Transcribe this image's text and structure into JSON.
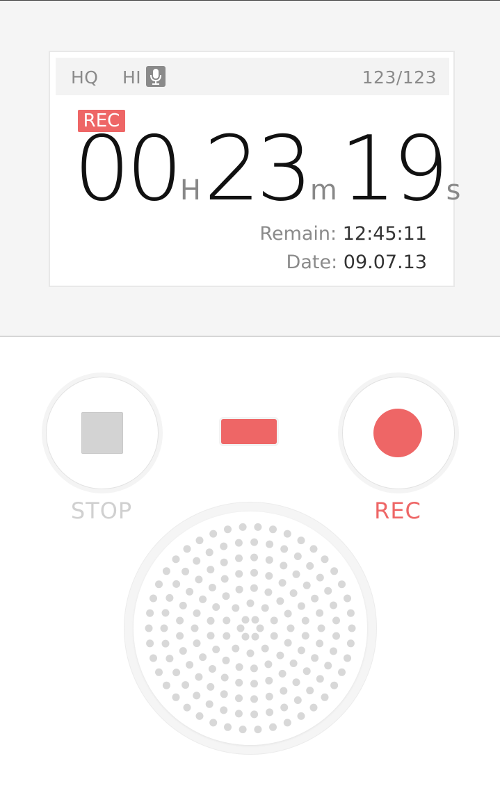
{
  "display": {
    "quality": "HQ",
    "mic_level": "HI",
    "file_counter": "123/123",
    "status_badge": "REC",
    "time": {
      "hours": "00",
      "hours_unit": "H",
      "minutes": "23",
      "minutes_unit": "m",
      "seconds": "19",
      "seconds_unit": "s"
    },
    "remain_label": "Remain:",
    "remain_value": "12:45:11",
    "date_label": "Date:",
    "date_value": "09.07.13"
  },
  "controls": {
    "stop_label": "STOP",
    "rec_label": "REC"
  },
  "icons": {
    "mic": "microphone-icon",
    "stop": "stop-square-icon",
    "record": "record-dot-icon",
    "level": "level-indicator",
    "speaker": "speaker-grille"
  },
  "colors": {
    "accent": "#ee6666",
    "display_bg": "#ffffff",
    "panel_bg": "#f5f5f5",
    "muted_text": "#8a8a8a",
    "disabled": "#d3d3d3"
  }
}
